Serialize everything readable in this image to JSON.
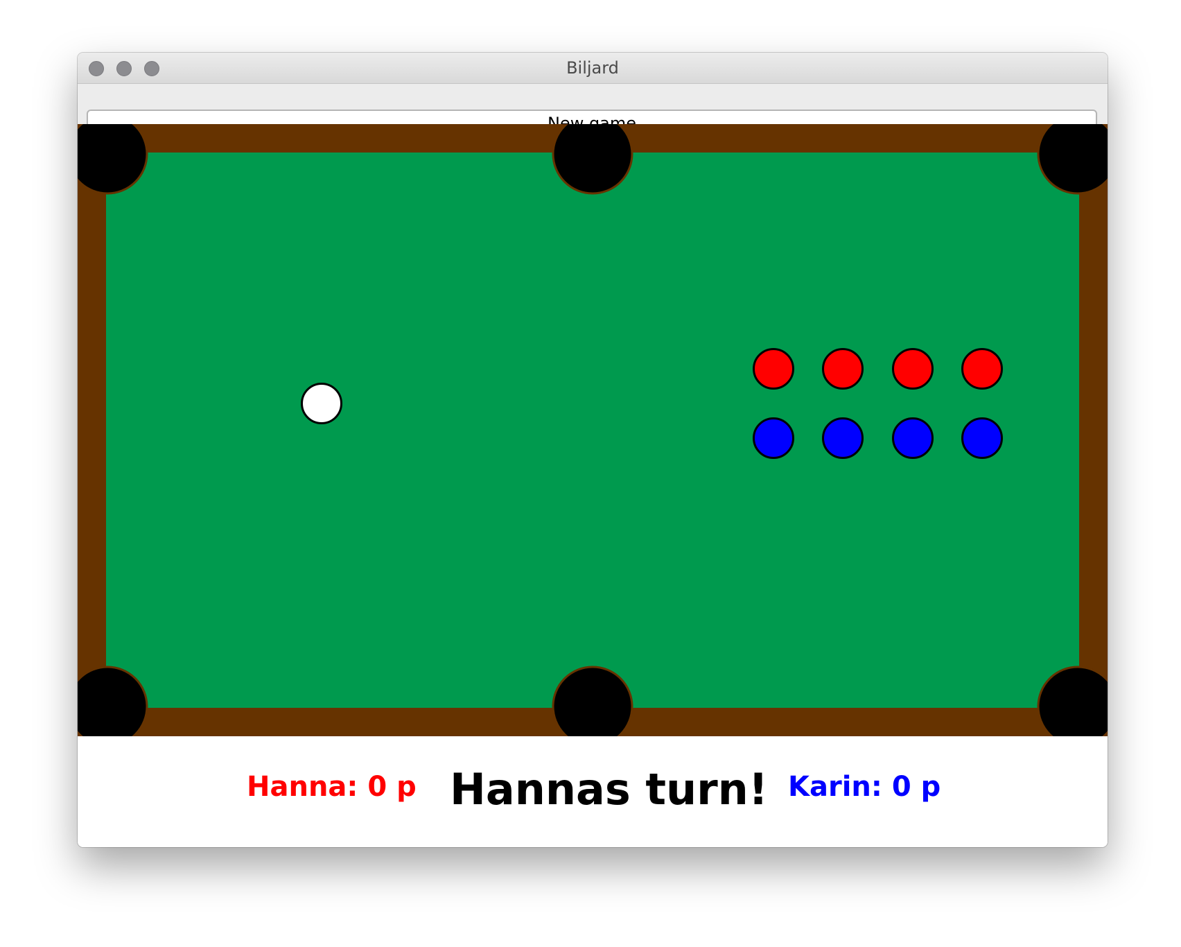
{
  "window": {
    "title": "Biljard"
  },
  "toolbar": {
    "new_game_label": "New game"
  },
  "table": {
    "felt_color": "#009a4e",
    "rail_color": "#663300",
    "pocket_color": "#000000",
    "pockets": [
      {
        "name": "top-left"
      },
      {
        "name": "top-middle"
      },
      {
        "name": "top-right"
      },
      {
        "name": "bottom-left"
      },
      {
        "name": "bottom-middle"
      },
      {
        "name": "bottom-right"
      }
    ],
    "cue_ball": {
      "color": "#ffffff"
    },
    "balls": [
      {
        "color": "#ff0000",
        "team": "red"
      },
      {
        "color": "#ff0000",
        "team": "red"
      },
      {
        "color": "#ff0000",
        "team": "red"
      },
      {
        "color": "#ff0000",
        "team": "red"
      },
      {
        "color": "#0000ff",
        "team": "blue"
      },
      {
        "color": "#0000ff",
        "team": "blue"
      },
      {
        "color": "#0000ff",
        "team": "blue"
      },
      {
        "color": "#0000ff",
        "team": "blue"
      }
    ]
  },
  "scoreboard": {
    "player1": {
      "label": "Hanna: 0 p",
      "color": "#ff0000"
    },
    "turn_text": "Hannas turn!",
    "player2": {
      "label": "Karin: 0 p",
      "color": "#0000ff"
    }
  }
}
